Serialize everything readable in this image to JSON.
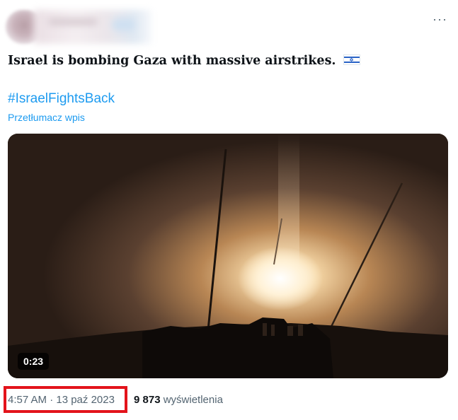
{
  "tweet": {
    "menu_icon": "more-horizontal-icon",
    "text": "Israel is bombing Gaza with massive airstrikes.",
    "emoji": "israel-flag-icon",
    "hashtag": "#IsraelFightsBack",
    "translate_label": "Przetłumacz wpis",
    "video": {
      "duration": "0:23"
    },
    "timestamp": "4:57 AM · 13 paź 2023",
    "views_count": "9 873",
    "views_label": "wyświetlenia"
  },
  "colors": {
    "link": "#1d9bf0",
    "highlight_box": "#e3131b",
    "secondary_text": "#536471"
  }
}
